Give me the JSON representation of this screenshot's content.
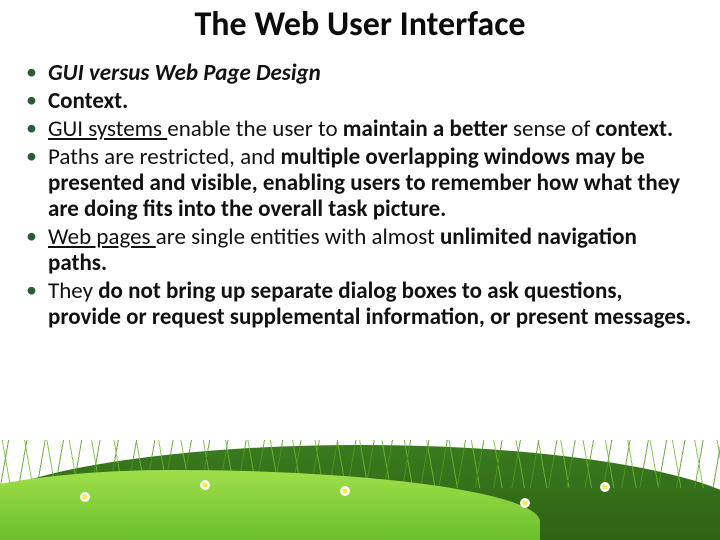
{
  "title": "The Web User Interface",
  "bullets": [
    {
      "segments": [
        {
          "text": "GUI versus Web Page Design",
          "style": "bi"
        }
      ]
    },
    {
      "segments": [
        {
          "text": "Context.",
          "style": "b"
        }
      ]
    },
    {
      "segments": [
        {
          "text": "GUI systems ",
          "style": "u"
        },
        {
          "text": "enable the user to ",
          "style": ""
        },
        {
          "text": "maintain a better ",
          "style": "b"
        },
        {
          "text": "sense of ",
          "style": ""
        },
        {
          "text": "context.",
          "style": "b"
        }
      ]
    },
    {
      "segments": [
        {
          "text": "Paths are restricted, and ",
          "style": ""
        },
        {
          "text": "multiple overlapping windows may be presented and visible",
          "style": "b"
        },
        {
          "text": ", enabling users to remember how what they are doing fits into the overall task picture",
          "style": "b"
        },
        {
          "text": ".",
          "style": "b"
        }
      ]
    },
    {
      "segments": [
        {
          "text": "Web pages ",
          "style": "u"
        },
        {
          "text": "are single entities with almost ",
          "style": ""
        },
        {
          "text": "unlimited navigation paths",
          "style": "b"
        },
        {
          "text": ".",
          "style": "b"
        }
      ]
    },
    {
      "segments": [
        {
          "text": "They ",
          "style": ""
        },
        {
          "text": "do not bring up separate dialog boxes to ask questions, provide or request supplemental information, or present messages.",
          "style": "b"
        }
      ]
    }
  ]
}
